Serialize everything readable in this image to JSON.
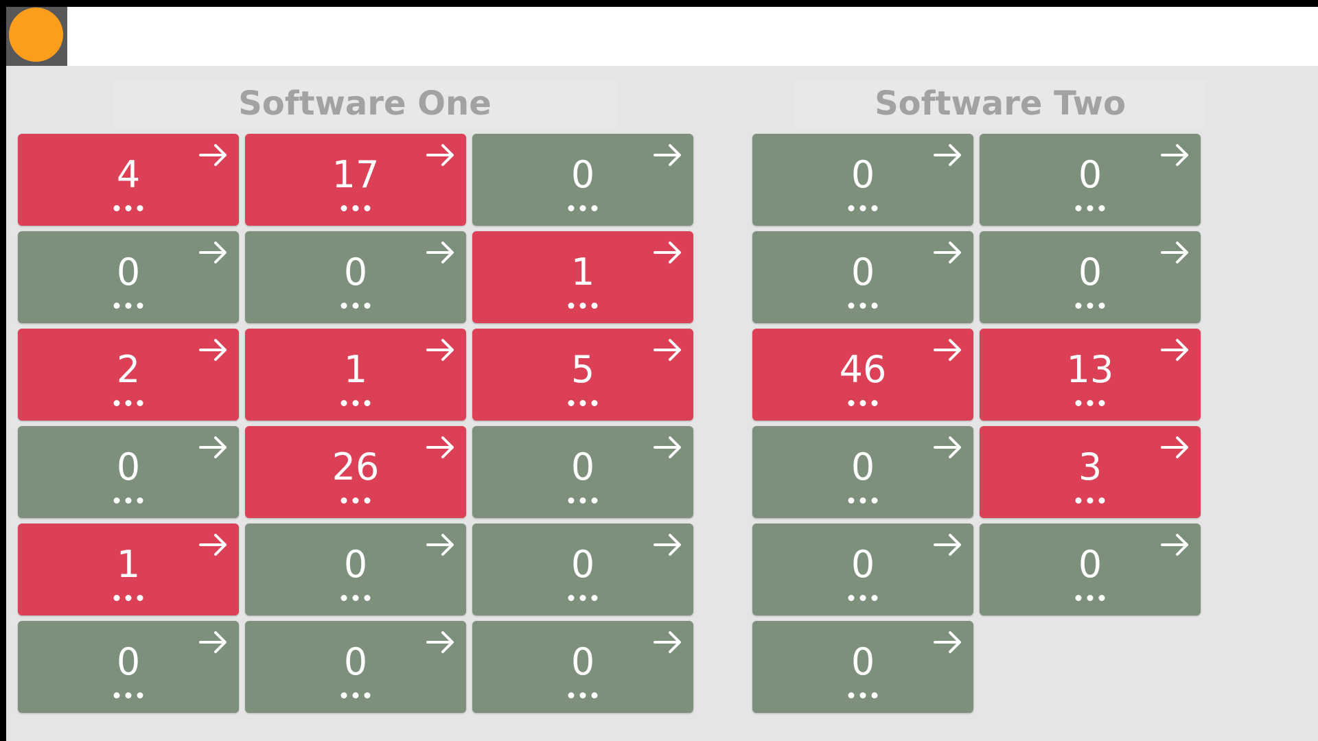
{
  "colors": {
    "alert": "#db4056",
    "ok": "#7c907c",
    "header_text": "#a2a2a2",
    "logo": "#fa9e1b",
    "background": "#e5e5e5"
  },
  "icons": {
    "logo": "orange-circle-logo",
    "tile_link": "arrow-right-icon",
    "tile_more": "more-dots-icon"
  },
  "sections": [
    {
      "title": "Software One",
      "tiles": [
        {
          "value": "4",
          "status": "alert"
        },
        {
          "value": "17",
          "status": "alert"
        },
        {
          "value": "0",
          "status": "ok"
        },
        {
          "value": "0",
          "status": "ok"
        },
        {
          "value": "0",
          "status": "ok"
        },
        {
          "value": "1",
          "status": "alert"
        },
        {
          "value": "2",
          "status": "alert"
        },
        {
          "value": "1",
          "status": "alert"
        },
        {
          "value": "5",
          "status": "alert"
        },
        {
          "value": "0",
          "status": "ok"
        },
        {
          "value": "26",
          "status": "alert"
        },
        {
          "value": "0",
          "status": "ok"
        },
        {
          "value": "1",
          "status": "alert"
        },
        {
          "value": "0",
          "status": "ok"
        },
        {
          "value": "0",
          "status": "ok"
        },
        {
          "value": "0",
          "status": "ok"
        },
        {
          "value": "0",
          "status": "ok"
        },
        {
          "value": "0",
          "status": "ok"
        }
      ]
    },
    {
      "title": "Software Two",
      "tiles": [
        {
          "value": "0",
          "status": "ok"
        },
        {
          "value": "0",
          "status": "ok"
        },
        {
          "value": "0",
          "status": "ok"
        },
        {
          "value": "0",
          "status": "ok"
        },
        {
          "value": "46",
          "status": "alert"
        },
        {
          "value": "13",
          "status": "alert"
        },
        {
          "value": "0",
          "status": "ok"
        },
        {
          "value": "3",
          "status": "alert"
        },
        {
          "value": "0",
          "status": "ok"
        },
        {
          "value": "0",
          "status": "ok"
        },
        {
          "value": "0",
          "status": "ok"
        }
      ]
    }
  ]
}
